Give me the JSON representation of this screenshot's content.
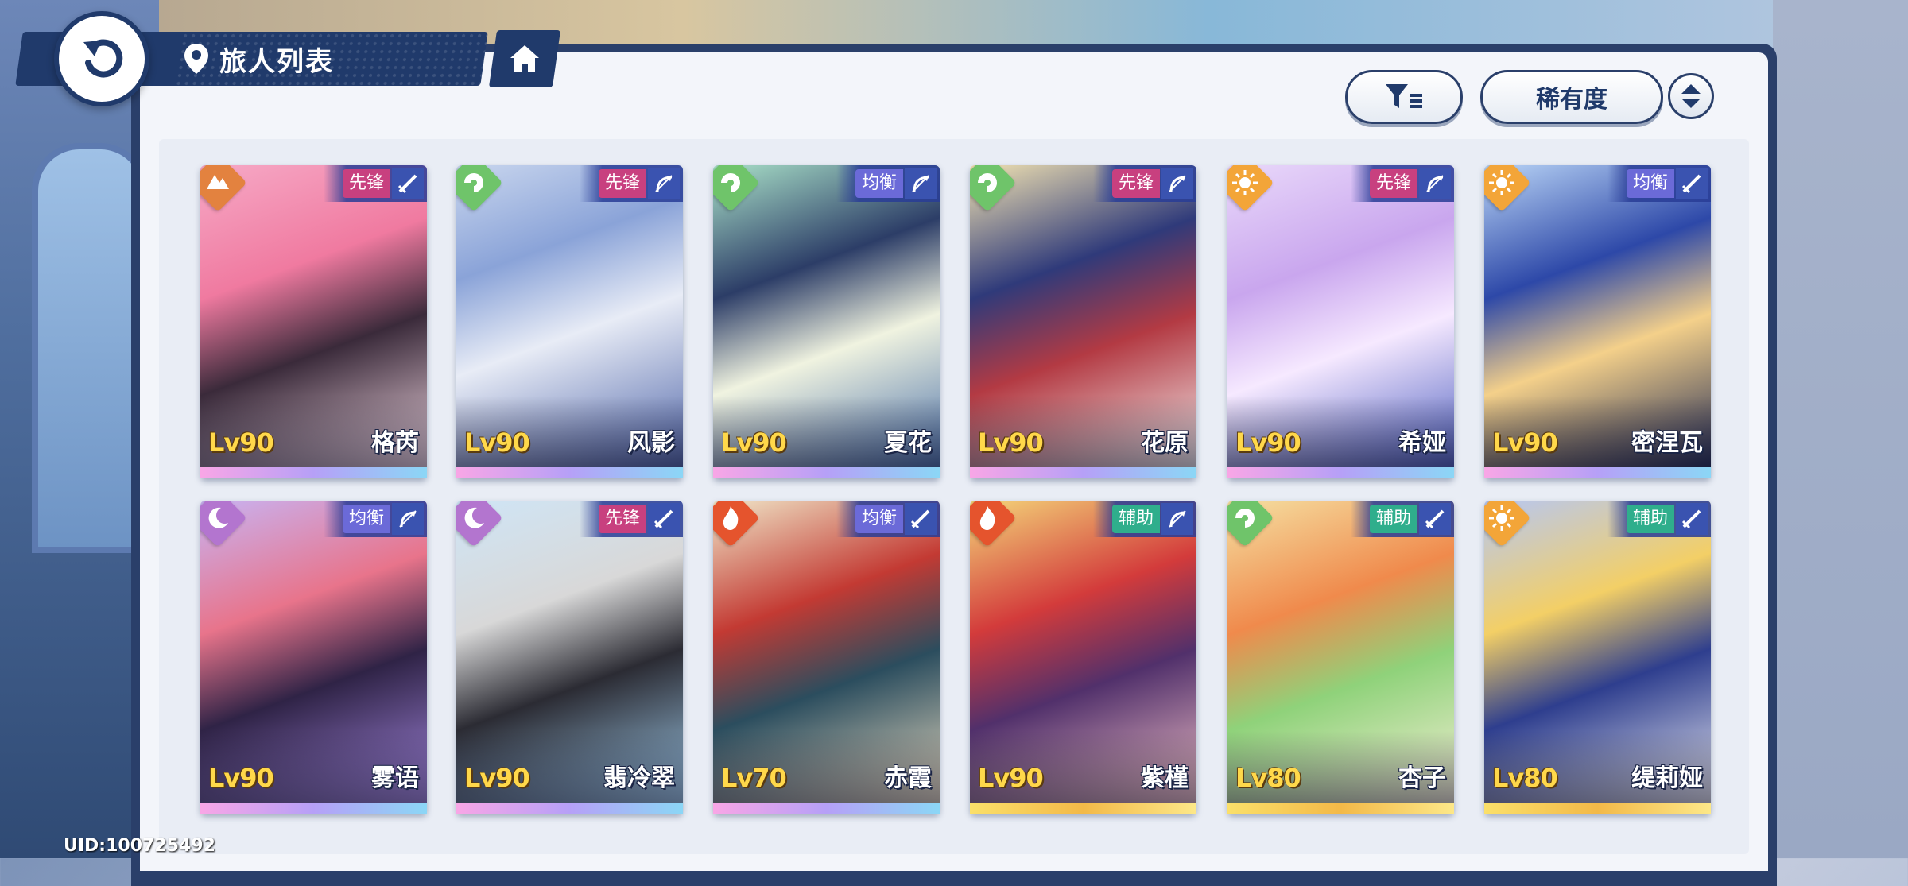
{
  "header": {
    "title": "旅人列表",
    "icons": {
      "back": "back-arrow-icon",
      "location": "location-pin-icon",
      "home": "home-icon"
    }
  },
  "toolbar": {
    "filter_icon": "filter-icon",
    "sort_label": "稀有度",
    "order_icon": "sort-order-icon"
  },
  "colors": {
    "header": "#203a6b",
    "panel": "#f3f5fa",
    "level_text": "#ffd84a",
    "vanguard": "#c8407f",
    "balance": "#6b6ad8",
    "support": "#2fae8c"
  },
  "characters": [
    {
      "name": "格芮",
      "level": "Lv90",
      "role": "先锋",
      "element": "earth-icon",
      "weapon": "sword-icon",
      "rarity": "rainbow"
    },
    {
      "name": "风影",
      "level": "Lv90",
      "role": "先锋",
      "element": "wind-icon",
      "weapon": "bow-icon",
      "rarity": "rainbow"
    },
    {
      "name": "夏花",
      "level": "Lv90",
      "role": "均衡",
      "element": "wind-icon",
      "weapon": "bow-icon",
      "rarity": "rainbow"
    },
    {
      "name": "花原",
      "level": "Lv90",
      "role": "先锋",
      "element": "wind-icon",
      "weapon": "bow-icon",
      "rarity": "rainbow"
    },
    {
      "name": "希娅",
      "level": "Lv90",
      "role": "先锋",
      "element": "light-icon",
      "weapon": "bow-icon",
      "rarity": "rainbow"
    },
    {
      "name": "密涅瓦",
      "level": "Lv90",
      "role": "均衡",
      "element": "light-icon",
      "weapon": "sword-icon",
      "rarity": "rainbow"
    },
    {
      "name": "雾语",
      "level": "Lv90",
      "role": "均衡",
      "element": "moon-icon",
      "weapon": "bow-icon",
      "rarity": "rainbow"
    },
    {
      "name": "翡冷翠",
      "level": "Lv90",
      "role": "先锋",
      "element": "moon-icon",
      "weapon": "sword-icon",
      "rarity": "rainbow"
    },
    {
      "name": "赤霞",
      "level": "Lv70",
      "role": "均衡",
      "element": "fire-icon",
      "weapon": "sword-icon",
      "rarity": "rainbow"
    },
    {
      "name": "紫槿",
      "level": "Lv90",
      "role": "辅助",
      "element": "fire-icon",
      "weapon": "bow-icon",
      "rarity": "gold"
    },
    {
      "name": "杏子",
      "level": "Lv80",
      "role": "辅助",
      "element": "wind-icon",
      "weapon": "sword-icon",
      "rarity": "gold"
    },
    {
      "name": "缇莉娅",
      "level": "Lv80",
      "role": "辅助",
      "element": "light-icon",
      "weapon": "sword-icon",
      "rarity": "gold"
    }
  ],
  "footer": {
    "uid": "UID:100725492"
  }
}
